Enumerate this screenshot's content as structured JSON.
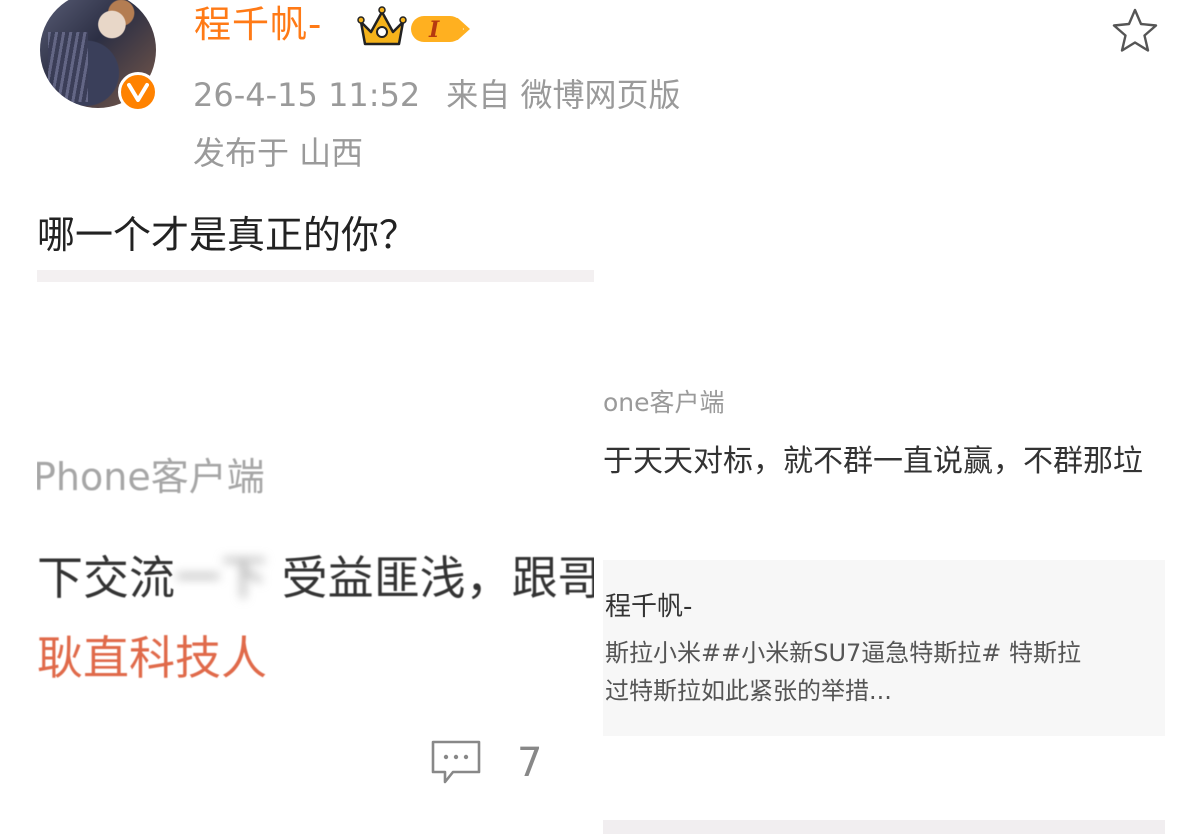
{
  "post": {
    "username": "程千帆-",
    "badge_level": "I",
    "timestamp": "26-4-15 11:52",
    "source": "来自 微博网页版",
    "location": "发布于 山西",
    "text": "哪一个才是真正的你？"
  },
  "images": {
    "left": {
      "client": "Phone客户端",
      "line1_start": "下交流",
      "line1_blurred": "一下",
      "line1_end": "受益匪浅，跟哥",
      "line2": "耿直科技人",
      "comment_count": "7"
    },
    "right": {
      "client": "one客户端",
      "text": "于天天对标，就不群一直说赢，不群那垃",
      "card_author": "程千帆-",
      "card_line1": "斯拉小米##小米新SU7逼急特斯拉# 特斯拉",
      "card_line2": "过特斯拉如此紧张的举措..."
    }
  },
  "colors": {
    "brand": "#ff7a16",
    "verified": "#ff8200",
    "meta": "#9a9a9a",
    "highlight_name": "#e06a4a"
  },
  "icons": {
    "star": "star-outline-icon",
    "comment": "comment-bubble-icon",
    "verified": "verified-v-icon",
    "crown": "crown-badge-icon"
  }
}
